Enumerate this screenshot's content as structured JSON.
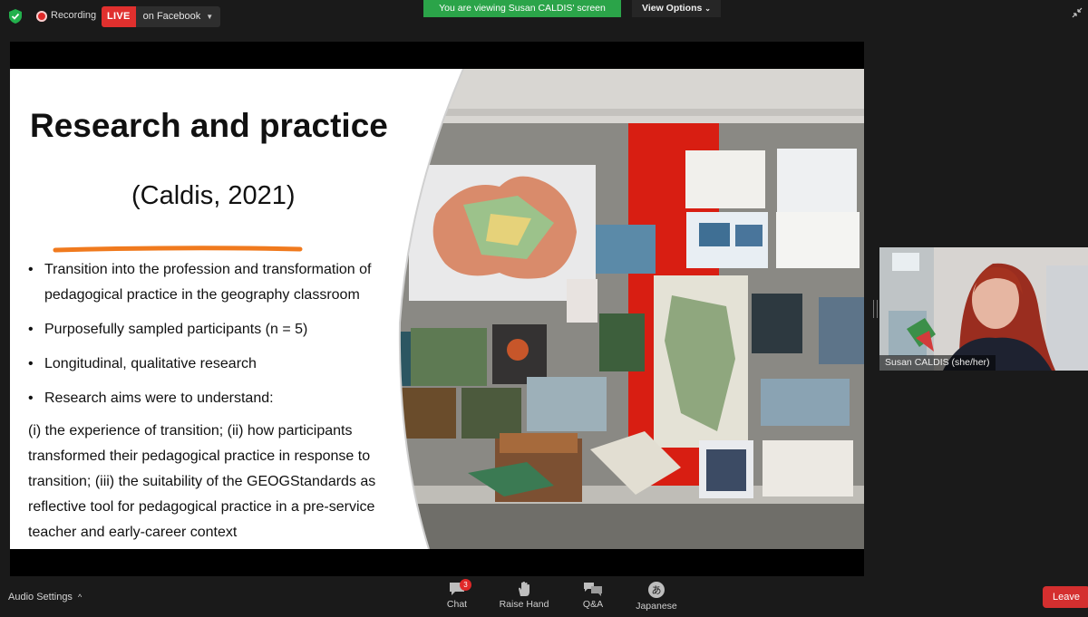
{
  "topbar": {
    "recording_label": "Recording",
    "live_label": "LIVE",
    "live_destination": "on Facebook",
    "viewing_banner": "You are viewing Susan CALDIS' screen",
    "view_options_label": "View Options"
  },
  "slide": {
    "title": "Research and practice",
    "citation": "(Caldis, 2021)",
    "bullets": [
      "Transition into the profession and transformation of pedagogical practice in the geography classroom",
      "Purposefully sampled participants (n = 5)",
      "Longitudinal, qualitative research",
      "Research aims were to understand:"
    ],
    "aims": "(i) the experience of transition; (ii) how participants transformed their pedagogical practice in response to transition; (iii) the suitability of the GEOGStandards as reflective tool for pedagogical practice in a pre-service teacher and early-career context"
  },
  "participant": {
    "name": "Susan CALDIS (she/her)"
  },
  "bottombar": {
    "audio_settings_label": "Audio Settings",
    "tools": [
      {
        "label": "Chat",
        "icon": "chat-icon",
        "badge": "3"
      },
      {
        "label": "Raise Hand",
        "icon": "hand-icon"
      },
      {
        "label": "Q&A",
        "icon": "qa-icon"
      },
      {
        "label": "Japanese",
        "icon": "language-icon",
        "glyph": "あ"
      }
    ],
    "leave_label": "Leave"
  },
  "colors": {
    "live_red": "#e0302e",
    "viewing_green": "#2ba449",
    "leave_red": "#d42f2f",
    "underline_orange": "#f07a1e"
  }
}
